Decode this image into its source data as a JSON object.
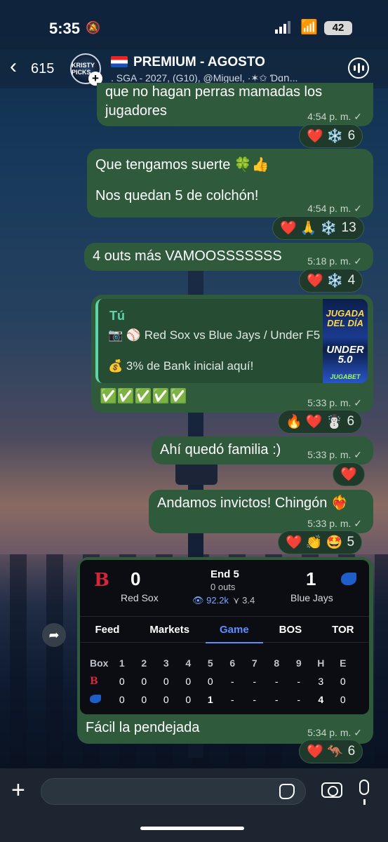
{
  "status": {
    "time": "5:35",
    "battery": "42"
  },
  "header": {
    "back_count": "615",
    "avatar_text": "KRISTY PICKS",
    "title": "PREMIUM - AGOSTO",
    "subtitle": ". SGA - 2027, (G10), @Miguel, ·✶✩ Ɗɑո..."
  },
  "messages": [
    {
      "text": "que no hagan perras mamadas los jugadores",
      "line1": "que no hagan perras mamadas los",
      "line2": "jugadores",
      "time": "4:54 p. m. ✓",
      "reactions": "❤️ ❄️",
      "count": "6"
    },
    {
      "line1": "Que tengamos suerte 🍀👍",
      "line2": "Nos quedan 5 de colchón!",
      "time": "4:54 p. m. ✓",
      "reactions": "❤️ 🙏 ❄️",
      "count": "13"
    },
    {
      "line1": "4 outs más VAMOOSSSSSSS",
      "time": "5:18 p. m. ✓",
      "reactions": "❤️ ❄️",
      "count": "4"
    },
    {
      "reply_author": "Tú",
      "reply_line1": "📷 ⚾ Red Sox vs Blue Jays / Under F5",
      "reply_line2": "💰 3% de Bank inicial aquí!",
      "thumb_top": "JUGADA DEL DÍA",
      "thumb_bottom": "UNDER 5.0",
      "thumb_brand": "JUGABET",
      "line1": "✅✅✅✅✅",
      "time": "5:33 p. m. ✓",
      "reactions": "🔥 ❤️ ☃️",
      "count": "6"
    },
    {
      "line1": "Ahí quedó familia :)",
      "time": "5:33 p. m. ✓",
      "reactions": "❤️"
    },
    {
      "line1": "Andamos invictos! Chingón ❤️‍🔥",
      "time": "5:33 p. m. ✓",
      "reactions": "❤️ 👏 🤩",
      "count": "5"
    },
    {
      "line1": "Fácil la pendejada",
      "time": "5:34 p. m. ✓",
      "reactions": "❤️ 🦘",
      "count": "6"
    }
  ],
  "score": {
    "away_logo": "B",
    "away_score": "0",
    "away_name": "Red Sox",
    "status": "End 5",
    "outs": "0 outs",
    "views": "👁 92.2k",
    "bets": "⋎ 3.4",
    "home_score": "1",
    "home_name": "Blue Jays",
    "tabs": [
      "Feed",
      "Markets",
      "Game",
      "BOS",
      "TOR"
    ],
    "header_row": [
      "Box",
      "1",
      "2",
      "3",
      "4",
      "5",
      "6",
      "7",
      "8",
      "9",
      "H",
      "E"
    ],
    "bos_row": [
      "0",
      "0",
      "0",
      "0",
      "0",
      "-",
      "-",
      "-",
      "-",
      "3",
      "0"
    ],
    "tor_row": [
      "0",
      "0",
      "0",
      "0",
      "1",
      "-",
      "-",
      "-",
      "-",
      "4",
      "0"
    ]
  },
  "colors": {
    "bubble": "#2f5a3c",
    "accent": "#5fd4a8",
    "tab_active": "#5b8fff"
  }
}
